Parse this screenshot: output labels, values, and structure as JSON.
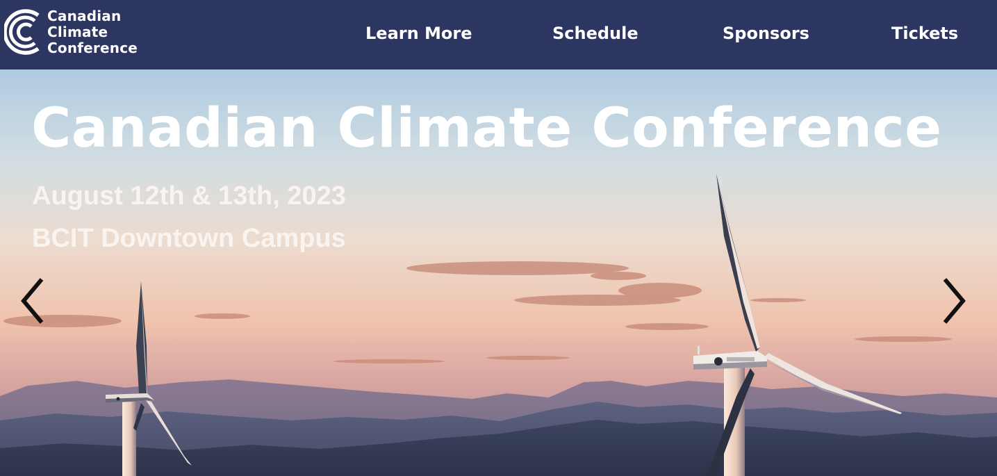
{
  "logo": {
    "lines": [
      "Canadian",
      "Climate",
      "Conference"
    ],
    "icon": "concentric-c-logo-icon"
  },
  "nav": {
    "items": [
      {
        "label": "Learn More"
      },
      {
        "label": "Schedule"
      },
      {
        "label": "Sponsors"
      },
      {
        "label": "Tickets"
      }
    ]
  },
  "hero": {
    "title": "Canadian Climate Conference",
    "date": "August 12th & 13th, 2023",
    "venue": "BCIT Downtown Campus",
    "background": "wind-turbines-mountains-sunset-image",
    "prev_icon": "chevron-left-icon",
    "next_icon": "chevron-right-icon"
  },
  "colors": {
    "header_bg": "#2d3561",
    "text": "#ffffff",
    "arrow": "#111111"
  }
}
